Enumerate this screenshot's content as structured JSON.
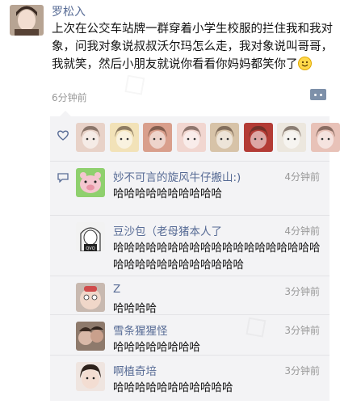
{
  "post": {
    "author": "罗松入",
    "text": "上次在公交车站牌一群穿着小学生校服的拦住我和我对象，问我对象说叔叔沃尔玛怎么走，我对象说叫哥哥，我就笑，然后小朋友就说你看看你妈妈都笑你了",
    "emoji_icon": "smile-emoji-icon",
    "time": "6分钟前",
    "comment_icon": "comment-more-icon"
  },
  "likes": {
    "icon": "heart-icon",
    "avatars": [
      {
        "name": "like-avatar-1",
        "color": "#e8d2c8"
      },
      {
        "name": "like-avatar-2",
        "color": "#f2e2b8"
      },
      {
        "name": "like-avatar-3",
        "color": "#d99f8c"
      },
      {
        "name": "like-avatar-4",
        "color": "#f1d6d0"
      },
      {
        "name": "like-avatar-5",
        "color": "#d7c3a8"
      },
      {
        "name": "like-avatar-6",
        "color": "#b33b35"
      },
      {
        "name": "like-avatar-7",
        "color": "#ece7de"
      },
      {
        "name": "like-avatar-8",
        "color": "#e8c2b8"
      }
    ]
  },
  "comments": [
    {
      "name": "妙不可言的旋风牛仔搬山:)",
      "time": "4分钟前",
      "text": "哈哈哈哈哈哈哈哈哈哈",
      "avatar_color": "#f4c6cf"
    },
    {
      "name": "豆沙包（老母猪本人了",
      "time": "4分钟前",
      "text": "哈哈哈哈哈哈哈哈哈哈哈哈哈哈哈哈哈哈哈哈哈哈哈哈哈哈哈哈哈哈哈",
      "avatar_color": "#eeeeee"
    },
    {
      "name": "Z",
      "time": "3分钟前",
      "text": "哈哈哈哈",
      "avatar_color": "#d9b0a4"
    },
    {
      "name": "雪条猩猩怪",
      "time": "3分钟前",
      "text": "哈哈哈哈哈哈哈哈",
      "avatar_color": "#c9a08c"
    },
    {
      "name": "啊植奇培",
      "time": "3分钟前",
      "text": "哈哈哈哈哈哈哈哈哈哈哈",
      "avatar_color": "#ecd8cf"
    }
  ]
}
